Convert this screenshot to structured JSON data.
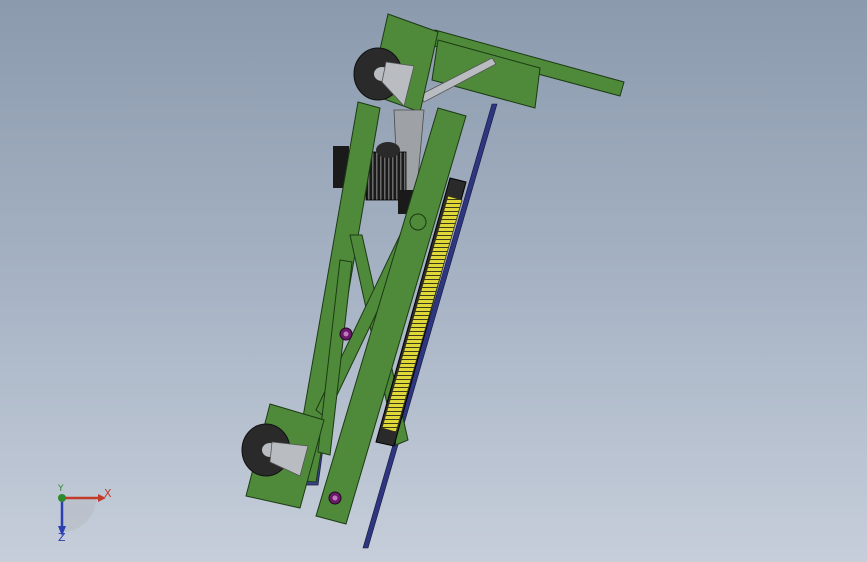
{
  "viewport": {
    "background_top": "#8b9aad",
    "background_bottom": "#c6ceda"
  },
  "model": {
    "frame_color": "#4e8a3a",
    "frame_edge_color": "#1c3a14",
    "belt_color": "#e0d838",
    "rail_color": "#3a3f8a",
    "wheel_color": "#2a2a2a",
    "bracket_color": "#b9bcc0"
  },
  "triad": {
    "x_label": "X",
    "y_label": "Y",
    "z_label": "Z",
    "x_color": "#c23a2a",
    "y_color": "#2e8a2e",
    "z_color": "#2a3fb0"
  }
}
